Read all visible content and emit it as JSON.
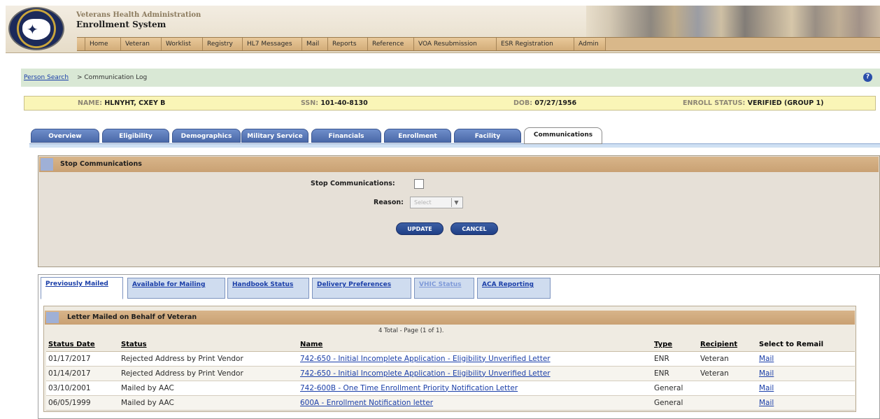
{
  "header": {
    "agency": "Veterans Health Administration",
    "system_title": "Enrollment System"
  },
  "nav": [
    "Home",
    "Veteran",
    "Worklist",
    "Registry",
    "HL7 Messages",
    "Mail",
    "Reports",
    "Reference",
    "VOA Resubmission",
    "ESR Registration",
    "Admin"
  ],
  "breadcrumb": {
    "link": "Person Search",
    "current": " > Communication Log"
  },
  "person": {
    "name_label": "NAME:",
    "name": "HLNYHT, CXEY B",
    "ssn_label": "SSN:",
    "ssn": "101-40-8130",
    "dob_label": "DOB:",
    "dob": "07/27/1956",
    "status_label": "ENROLL STATUS:",
    "status": "VERIFIED (GROUP 1)"
  },
  "tabs": [
    "Overview",
    "Eligibility",
    "Demographics",
    "Military Service",
    "Financials",
    "Enrollment",
    "Facility",
    "Communications"
  ],
  "stop": {
    "title": "Stop Communications",
    "checkbox_label": "Stop Communications:",
    "reason_label": "Reason:",
    "reason_value": "Select",
    "update": "UPDATE",
    "cancel": "CANCEL"
  },
  "comm_tabs": [
    "Previously Mailed",
    "Available for Mailing",
    "Handbook Status",
    "Delivery Preferences",
    "VHIC Status",
    "ACA Reporting"
  ],
  "letters": {
    "title": "Letter Mailed on Behalf of Veteran",
    "count": "4 Total - Page (1 of 1).",
    "columns": [
      "Status Date",
      "Status",
      "Name",
      "Type",
      "Recipient",
      "Select to Remail"
    ],
    "rows": [
      [
        "01/17/2017",
        "Rejected Address by Print Vendor",
        "742-650 - Initial Incomplete Application - Eligibility Unverified Letter",
        "ENR",
        "Veteran",
        "Mail"
      ],
      [
        "01/14/2017",
        "Rejected Address by Print Vendor",
        "742-650 - Initial Incomplete Application - Eligibility Unverified Letter",
        "ENR",
        "Veteran",
        "Mail"
      ],
      [
        "03/10/2001",
        "Mailed by AAC",
        "742-600B - One Time Enrollment Priority Notification Letter",
        "General",
        "",
        "Mail"
      ],
      [
        "06/05/1999",
        "Mailed by AAC",
        "600A - Enrollment Notification letter",
        "General",
        "",
        "Mail"
      ]
    ]
  }
}
